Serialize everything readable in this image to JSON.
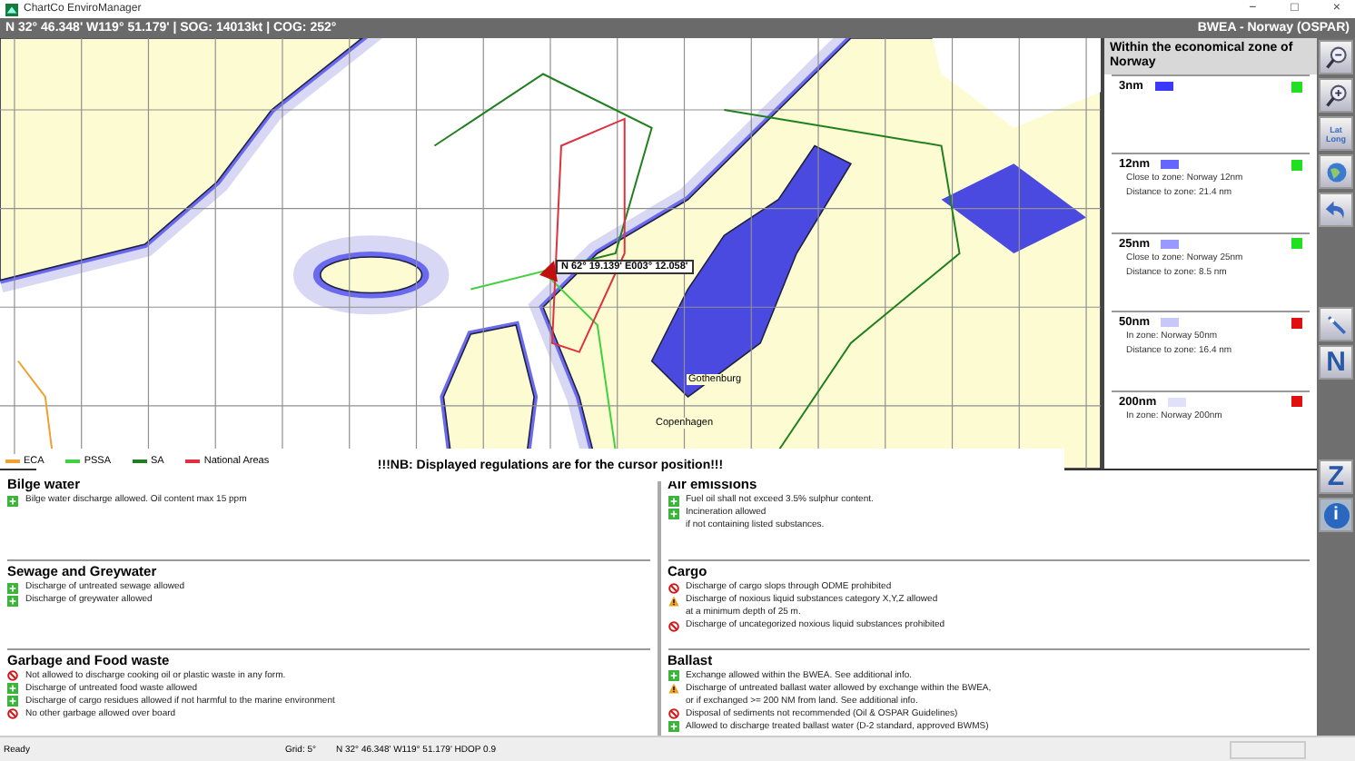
{
  "window": {
    "title": "ChartCo EnviroManager",
    "controls": [
      "−",
      "□",
      "×"
    ]
  },
  "header": {
    "position": "N 32° 46.348'  W119° 51.179' | SOG: 14013kt | COG: 252°",
    "area": "BWEA - Norway (OSPAR)"
  },
  "map": {
    "cursor_label": "N 62° 19.139' E003° 12.058'",
    "places": [
      "Gothenburg",
      "Copenhagen"
    ],
    "notice": "!!!NB: Displayed regulations are for the cursor position!!!",
    "legend": [
      {
        "label": "ECA",
        "color": "#f0a030"
      },
      {
        "label": "PSSA",
        "color": "#40d040"
      },
      {
        "label": "SA",
        "color": "#208020"
      },
      {
        "label": "National Areas",
        "color": "#e03040"
      }
    ]
  },
  "zones": {
    "title": "Within the economical zone of Norway",
    "items": [
      {
        "name": "3nm",
        "color": "#3a3aff",
        "inside": false
      },
      {
        "name": "12nm",
        "color": "#6666ff",
        "inside": false,
        "details": [
          "Close to zone: Norway 12nm",
          "Distance to zone: 21.4 nm"
        ]
      },
      {
        "name": "25nm",
        "color": "#9999ff",
        "inside": false,
        "details": [
          "Close to zone: Norway 25nm",
          "Distance to zone: 8.5 nm"
        ]
      },
      {
        "name": "50nm",
        "color": "#c8c8f8",
        "inside": true,
        "details": [
          "In zone: Norway 50nm",
          "Distance to zone: 16.4 nm"
        ]
      },
      {
        "name": "200nm",
        "color": "#e0e0fa",
        "inside": true,
        "details": [
          "In zone: Norway 200nm"
        ]
      }
    ]
  },
  "tools": [
    {
      "kind": "zoom-out"
    },
    {
      "kind": "zoom-in"
    },
    {
      "kind": "latlong",
      "label": "Lat Long"
    },
    {
      "kind": "globe"
    },
    {
      "kind": "back"
    },
    {
      "kind": "gap"
    },
    {
      "kind": "compass"
    },
    {
      "kind": "letter",
      "label": "N"
    },
    {
      "kind": "gap"
    },
    {
      "kind": "letter",
      "label": "Z"
    },
    {
      "kind": "info",
      "label": "i"
    }
  ],
  "regulations": [
    [
      {
        "title": "Bilge water",
        "lines": [
          {
            "kind": "allowed",
            "text": "Bilge water discharge allowed. Oil content max 15 ppm"
          }
        ]
      },
      {
        "title": "Sewage and Greywater",
        "lines": [
          {
            "kind": "allowed",
            "text": "Discharge of untreated sewage allowed"
          },
          {
            "kind": "allowed",
            "text": "Discharge of greywater allowed"
          }
        ]
      },
      {
        "title": "Garbage and Food waste",
        "lines": [
          {
            "kind": "prohibited",
            "text": "Not allowed to discharge cooking oil or plastic waste in any form."
          },
          {
            "kind": "allowed",
            "text": "Discharge of untreated food waste allowed"
          },
          {
            "kind": "allowed",
            "text": "Discharge of cargo residues allowed if not harmful to the marine environment"
          },
          {
            "kind": "prohibited",
            "text": "No other garbage allowed over board"
          }
        ]
      }
    ],
    [
      {
        "title": "Air emissions",
        "lines": [
          {
            "kind": "allowed",
            "text": "Fuel oil shall not exceed 3.5% sulphur content."
          },
          {
            "kind": "allowed",
            "text": "Incineration allowed"
          },
          {
            "kind": "note",
            "text": "if not containing listed substances."
          }
        ]
      },
      {
        "title": "Cargo",
        "lines": [
          {
            "kind": "prohibited",
            "text": "Discharge of cargo slops through ODME prohibited"
          },
          {
            "kind": "warning",
            "text": "Discharge of noxious liquid substances category X,Y,Z allowed"
          },
          {
            "kind": "note",
            "text": "at a minimum depth of 25 m."
          },
          {
            "kind": "prohibited",
            "text": "Discharge of uncategorized noxious liquid substances prohibited"
          }
        ]
      },
      {
        "title": "Ballast",
        "lines": [
          {
            "kind": "allowed",
            "text": "Exchange allowed within the BWEA. See additional info."
          },
          {
            "kind": "warning",
            "text": "Discharge of untreated ballast water allowed by exchange within the BWEA,"
          },
          {
            "kind": "note",
            "text": "or if exchanged >= 200 NM from land. See additional info."
          },
          {
            "kind": "prohibited",
            "text": "Disposal of sediments not recommended (Oil & OSPAR Guidelines)"
          },
          {
            "kind": "allowed",
            "text": "Allowed to discharge treated ballast water (D-2 standard, approved BWMS)"
          }
        ]
      }
    ]
  ],
  "status_bar": {
    "state": "Ready",
    "grid": "Grid: 5°",
    "position": "N 32° 46.348'  W119° 51.179'  HDOP 0.9"
  }
}
